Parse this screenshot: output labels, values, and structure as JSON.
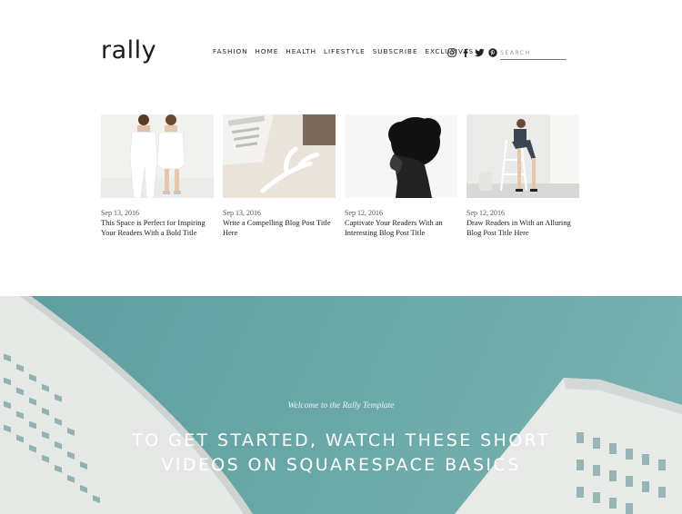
{
  "header": {
    "logo": "rally",
    "nav": [
      "FASHION",
      "HOME",
      "HEALTH",
      "LIFESTYLE",
      "SUBSCRIBE",
      "EXCLUSIVES"
    ],
    "social_icons": [
      "instagram-icon",
      "facebook-icon",
      "twitter-icon",
      "pinterest-icon"
    ],
    "search_placeholder": "SEARCH"
  },
  "posts": [
    {
      "date": "Sep 13, 2016",
      "title": "This Space is Perfect for Inspiring Your Readers With a Bold Title",
      "image": "two-women-in-white"
    },
    {
      "date": "Sep 13, 2016",
      "title": "Write a Compelling Blog Post Title Here",
      "image": "book-and-antler"
    },
    {
      "date": "Sep 12, 2016",
      "title": "Captivate Your Readers With an Interesting Blog Post Title",
      "image": "woman-profile-afro"
    },
    {
      "date": "Sep 12, 2016",
      "title": "Draw Readers in With an Alluring Blog Post Title Here",
      "image": "woman-on-ladder"
    }
  ],
  "hero": {
    "subtitle": "Welcome to the Rally Template",
    "title_line1": "TO GET STARTED, WATCH THESE SHORT",
    "title_line2": "VIDEOS ON SQUARESPACE BASICS",
    "colors": {
      "sky": "#6aa8a8",
      "building": "#e4e6e4"
    }
  }
}
